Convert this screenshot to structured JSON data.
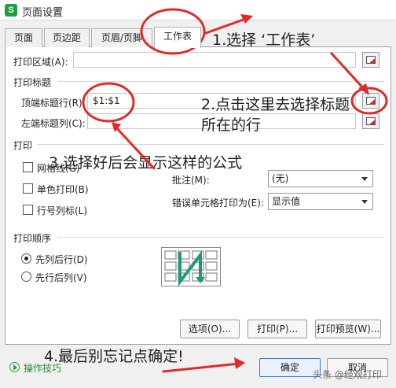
{
  "window": {
    "icon_letter": "S",
    "title": "页面设置"
  },
  "tabs": [
    {
      "label": "页面"
    },
    {
      "label": "页边距"
    },
    {
      "label": "页眉/页脚"
    },
    {
      "label": "工作表",
      "active": true
    }
  ],
  "print_area": {
    "label": "打印区域(A):",
    "value": ""
  },
  "print_titles": {
    "section_label": "打印标题",
    "top_row": {
      "label": "顶端标题行(R):",
      "value": "$1:$1"
    },
    "left_col": {
      "label": "左端标题列(C):",
      "value": ""
    }
  },
  "print_section": {
    "section_label": "打印",
    "checkboxes": [
      {
        "label": "网格线(G)",
        "checked": false
      },
      {
        "label": "单色打印(B)",
        "checked": false
      },
      {
        "label": "行号列标(L)",
        "checked": false
      }
    ],
    "comments": {
      "label": "批注(M):",
      "value": "(无)"
    },
    "error_cells": {
      "label": "错误单元格打印为(E):",
      "value": "显示值"
    }
  },
  "order_section": {
    "section_label": "打印顺序",
    "options": [
      {
        "label": "先列后行(D)",
        "selected": true
      },
      {
        "label": "先行后列(V)",
        "selected": false
      }
    ]
  },
  "buttons": {
    "options": "选项(O)...",
    "print": "打印(P)...",
    "preview": "打印预览(W)...",
    "ok": "确定",
    "cancel": "取消"
  },
  "footer": {
    "help_link": "操作技巧",
    "watermark": "头条 @经观打印"
  },
  "annotations": {
    "step1": "1.选择 ‘工作表’",
    "step2_line1": "2.点击这里去选择标题",
    "step2_line2": "所在的行",
    "step3": "3.选择好后会显示这样的公式",
    "step4": "4.最后别忘记点确定!"
  },
  "colors": {
    "annotation_red": "#e02a2a",
    "help_green": "#2a8a2a",
    "ok_border": "#3b7ed8"
  }
}
